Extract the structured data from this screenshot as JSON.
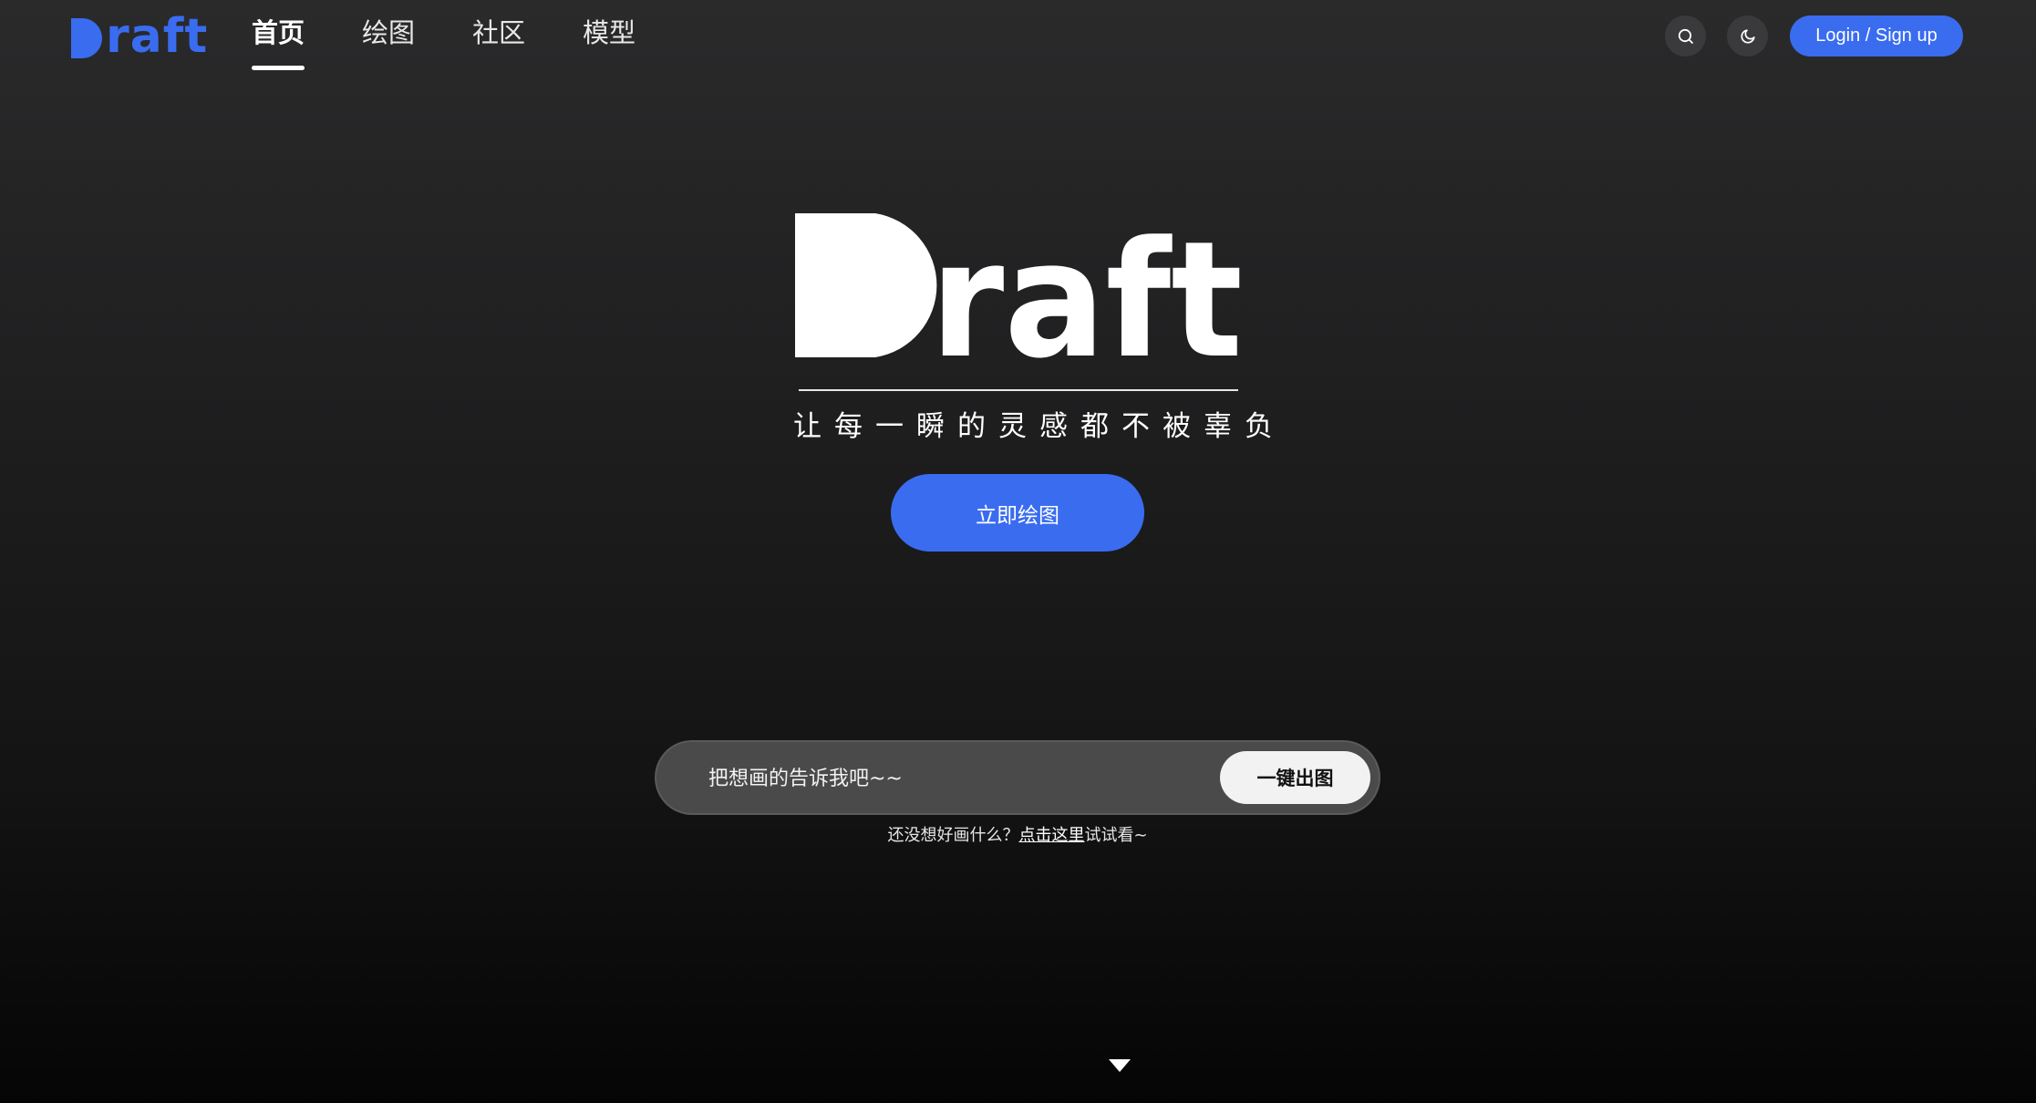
{
  "header": {
    "brand": "Draft",
    "nav": [
      {
        "label": "首页",
        "active": true
      },
      {
        "label": "绘图",
        "active": false
      },
      {
        "label": "社区",
        "active": false
      },
      {
        "label": "模型",
        "active": false
      }
    ],
    "search_icon": "search-icon",
    "theme_icon": "moon-icon",
    "login_label": "Login / Sign up"
  },
  "hero": {
    "logo_text": "Draft",
    "tagline": "让每一瞬的灵感都不被辜负",
    "cta_label": "立即绘图"
  },
  "prompt": {
    "placeholder": "把想画的告诉我吧~~",
    "value": "",
    "button_label": "一键出图",
    "hint_prefix": "还没想好画什么？",
    "hint_link": "点击这里",
    "hint_suffix": "试试看~"
  },
  "colors": {
    "accent": "#3a6cf0",
    "background": "#1f1f20"
  },
  "scroll_icon": "caret-down-icon"
}
